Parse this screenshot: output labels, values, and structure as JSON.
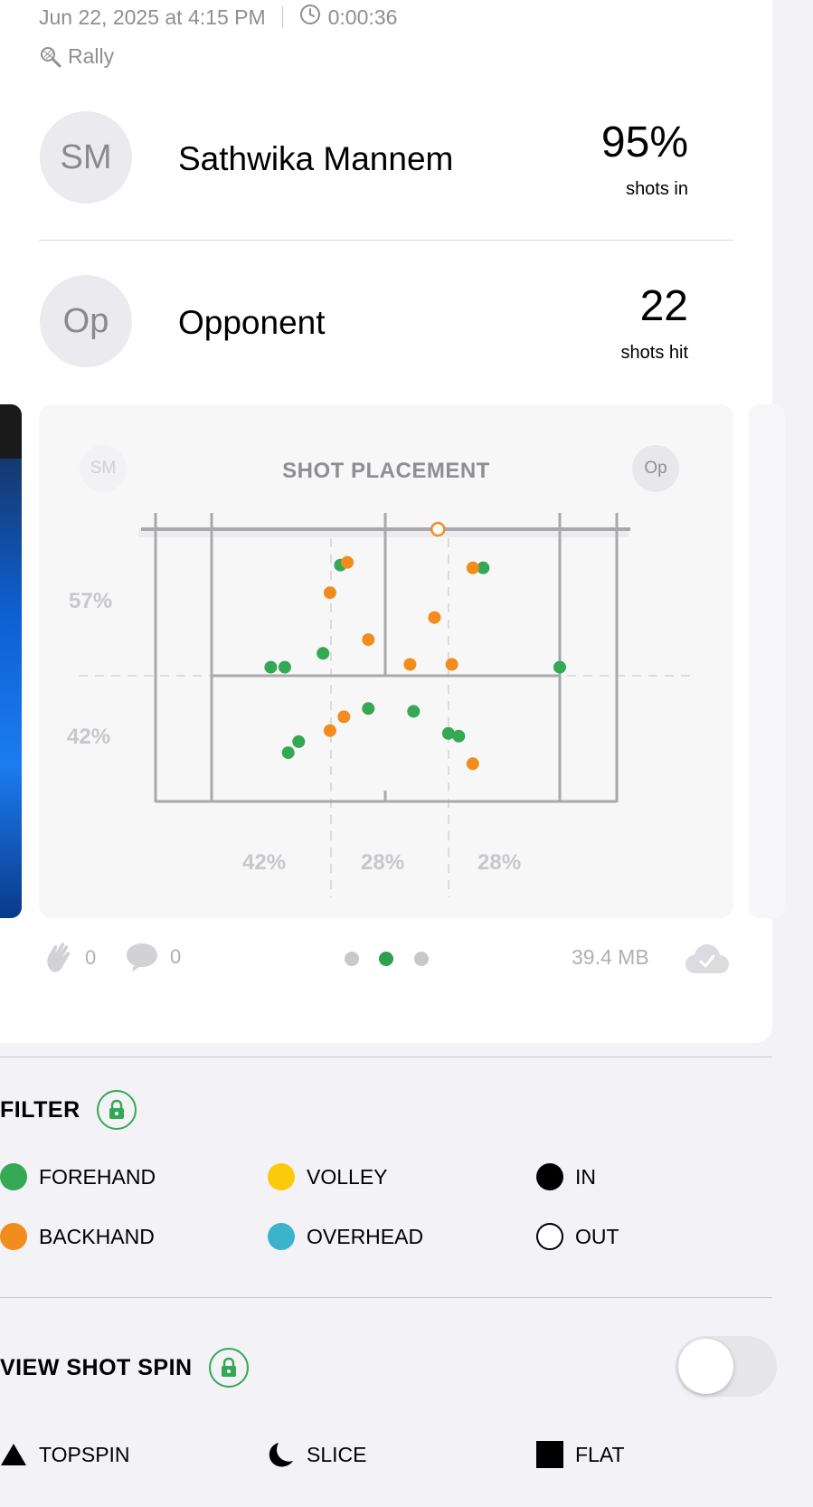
{
  "header": {
    "date": "Jun 22, 2025 at 4:15 PM",
    "duration": "0:00:36",
    "mode": "Rally"
  },
  "players": [
    {
      "initials": "SM",
      "name": "Sathwika Mannem",
      "stat_value": "95%",
      "stat_label": "shots in"
    },
    {
      "initials": "Op",
      "name": "Opponent",
      "stat_value": "22",
      "stat_label": "shots hit"
    }
  ],
  "placement_card": {
    "title": "SHOT PLACEMENT",
    "left_avatar": "SM",
    "right_avatar": "Op",
    "row_percents": [
      "57%",
      "42%"
    ],
    "col_percents": [
      "42%",
      "28%",
      "28%"
    ]
  },
  "chart_data": {
    "type": "scatter",
    "title": "SHOT PLACEMENT",
    "x_range": [
      0,
      1
    ],
    "y_range": [
      0,
      1
    ],
    "series": [
      {
        "name": "FOREHAND",
        "color": "#34a853",
        "points": [
          [
            0.37,
            0.14
          ],
          [
            0.78,
            0.15
          ],
          [
            0.32,
            0.46
          ],
          [
            0.17,
            0.51
          ],
          [
            0.21,
            0.51
          ],
          [
            0.58,
            0.67
          ],
          [
            0.25,
            0.78
          ],
          [
            0.22,
            0.82
          ],
          [
            0.68,
            0.75
          ],
          [
            0.71,
            0.76
          ],
          [
            1.0,
            0.51
          ],
          [
            0.45,
            0.66
          ]
        ]
      },
      {
        "name": "BACKHAND",
        "color": "#f28c1d",
        "points": [
          [
            0.39,
            0.13
          ],
          [
            0.34,
            0.24
          ],
          [
            0.75,
            0.15
          ],
          [
            0.64,
            0.33
          ],
          [
            0.45,
            0.41
          ],
          [
            0.57,
            0.5
          ],
          [
            0.69,
            0.5
          ],
          [
            0.38,
            0.69
          ],
          [
            0.34,
            0.74
          ],
          [
            0.75,
            0.86
          ]
        ]
      },
      {
        "name": "OUT",
        "color": "#f28c1d",
        "points": [
          [
            0.65,
            0.01
          ]
        ]
      }
    ]
  },
  "footer": {
    "claps": "0",
    "comments": "0",
    "size": "39.4 MB",
    "pages": 3,
    "active_page": 1
  },
  "filter": {
    "title": "FILTER",
    "items": [
      {
        "label": "FOREHAND",
        "color": "#34a853"
      },
      {
        "label": "VOLLEY",
        "color": "#fcc90b"
      },
      {
        "label": "IN",
        "color": "#000000"
      },
      {
        "label": "BACKHAND",
        "color": "#f28c1d"
      },
      {
        "label": "OVERHEAD",
        "color": "#3bb3c9"
      },
      {
        "label": "OUT",
        "color": "outline"
      }
    ]
  },
  "spin": {
    "title": "VIEW SHOT SPIN",
    "toggle_on": false,
    "items": [
      {
        "label": "TOPSPIN",
        "icon": "triangle-icon"
      },
      {
        "label": "SLICE",
        "icon": "crescent-icon"
      },
      {
        "label": "FLAT",
        "icon": "square-icon"
      }
    ]
  }
}
